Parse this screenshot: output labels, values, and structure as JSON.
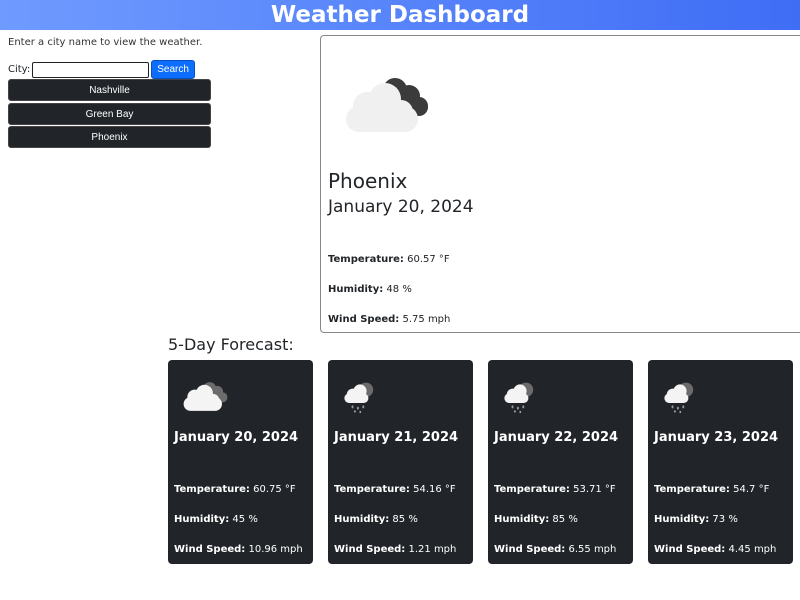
{
  "header": {
    "title": "Weather Dashboard"
  },
  "search": {
    "intro": "Enter a city name to view the weather.",
    "city_label": "City:",
    "input_value": "",
    "button_label": "Search"
  },
  "history": [
    {
      "label": "Nashville"
    },
    {
      "label": "Green Bay"
    },
    {
      "label": "Phoenix"
    }
  ],
  "labels": {
    "temperature": "Temperature:",
    "humidity": "Humidity:",
    "wind": "Wind Speed:"
  },
  "current": {
    "icon": "cloudy-icon",
    "city": "Phoenix",
    "date": "January 20, 2024",
    "temperature": "60.57 °F",
    "humidity": "48 %",
    "wind": "5.75 mph"
  },
  "forecast_title": "5-Day Forecast:",
  "forecast": [
    {
      "icon": "cloudy-icon",
      "date": "January 20, 2024",
      "temperature": "60.75 °F",
      "humidity": "45 %",
      "wind": "10.96 mph"
    },
    {
      "icon": "rain-cloud-icon",
      "date": "January 21, 2024",
      "temperature": "54.16 °F",
      "humidity": "85 %",
      "wind": "1.21 mph"
    },
    {
      "icon": "rain-cloud-icon",
      "date": "January 22, 2024",
      "temperature": "53.71 °F",
      "humidity": "85 %",
      "wind": "6.55 mph"
    },
    {
      "icon": "rain-cloud-icon",
      "date": "January 23, 2024",
      "temperature": "54.7 °F",
      "humidity": "73 %",
      "wind": "4.45 mph"
    }
  ]
}
